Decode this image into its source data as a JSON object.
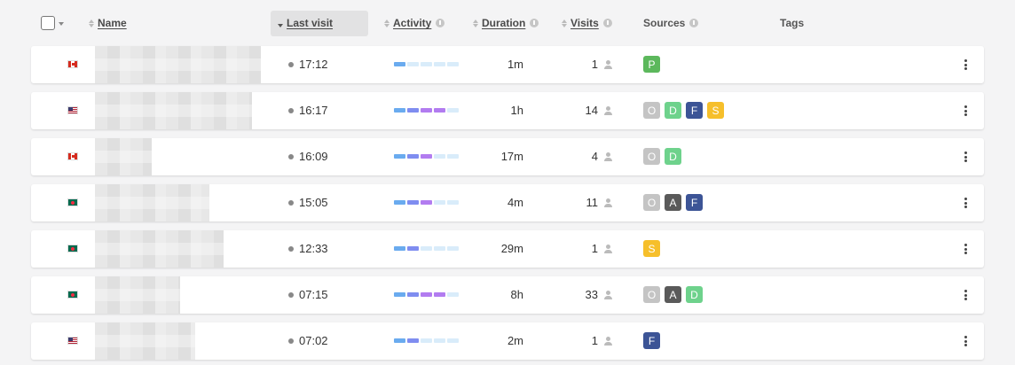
{
  "header": {
    "name": "Name",
    "last_visit": "Last visit",
    "activity": "Activity",
    "duration": "Duration",
    "visits": "Visits",
    "sources": "Sources",
    "tags": "Tags"
  },
  "source_colors": {
    "P": "#5cb85c",
    "O": "#c4c4c4",
    "D": "#6ed28c",
    "F": "#3c5496",
    "S": "#f6bf2b",
    "A": "#5a5a5a"
  },
  "rows": [
    {
      "flag": "ca",
      "time": "17:12",
      "activity": [
        1,
        0,
        0,
        0,
        0
      ],
      "duration": "1m",
      "visits": "1",
      "sources": [
        "P"
      ]
    },
    {
      "flag": "us",
      "time": "16:17",
      "activity": [
        1,
        2,
        3,
        3,
        0
      ],
      "duration": "1h",
      "visits": "14",
      "sources": [
        "O",
        "D",
        "F",
        "S"
      ]
    },
    {
      "flag": "ca",
      "time": "16:09",
      "activity": [
        1,
        2,
        3,
        0,
        0
      ],
      "duration": "17m",
      "visits": "4",
      "sources": [
        "O",
        "D"
      ]
    },
    {
      "flag": "bd",
      "time": "15:05",
      "activity": [
        1,
        2,
        3,
        0,
        0
      ],
      "duration": "4m",
      "visits": "11",
      "sources": [
        "O",
        "A",
        "F"
      ]
    },
    {
      "flag": "bd",
      "time": "12:33",
      "activity": [
        1,
        2,
        0,
        0,
        0
      ],
      "duration": "29m",
      "visits": "1",
      "sources": [
        "S"
      ]
    },
    {
      "flag": "bd",
      "time": "07:15",
      "activity": [
        1,
        2,
        3,
        3,
        0
      ],
      "duration": "8h",
      "visits": "33",
      "sources": [
        "O",
        "A",
        "D"
      ]
    },
    {
      "flag": "us",
      "time": "07:02",
      "activity": [
        1,
        2,
        0,
        0,
        0
      ],
      "duration": "2m",
      "visits": "1",
      "sources": [
        "F"
      ]
    }
  ]
}
